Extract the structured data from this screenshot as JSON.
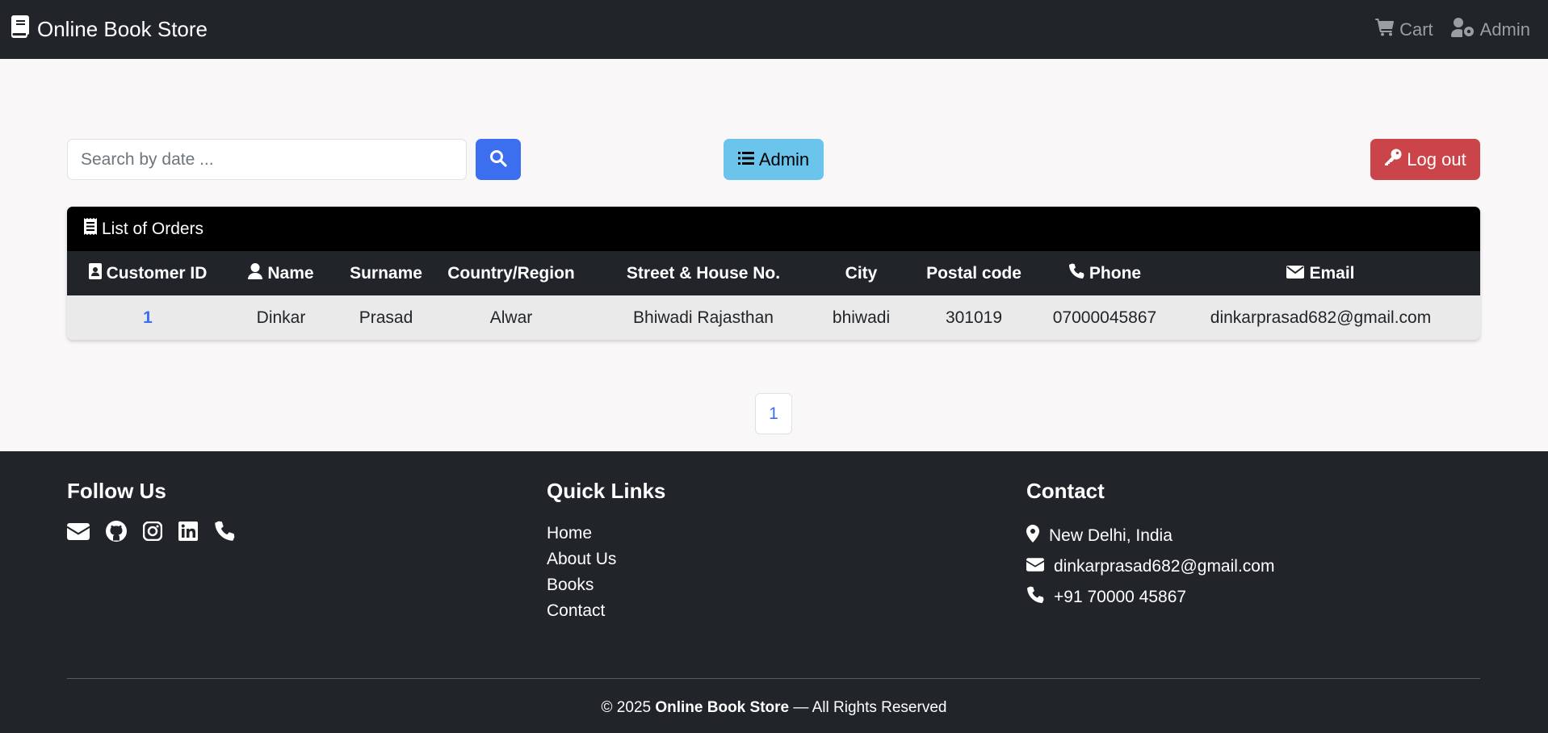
{
  "navbar": {
    "brand": "Online Book Store",
    "cart_label": "Cart",
    "admin_label": "Admin"
  },
  "controls": {
    "search_placeholder": "Search by date ...",
    "admin_button_label": "Admin",
    "logout_button_label": "Log out"
  },
  "orders": {
    "title": "List of Orders",
    "columns": [
      "Customer ID",
      "Name",
      "Surname",
      "Country/Region",
      "Street & House No.",
      "City",
      "Postal code",
      "Phone",
      "Email"
    ],
    "rows": [
      {
        "customer_id": "1",
        "name": "Dinkar",
        "surname": "Prasad",
        "country": "Alwar",
        "street": "Bhiwadi Rajasthan",
        "city": "bhiwadi",
        "postal_code": "301019",
        "phone": "07000045867",
        "email": "dinkarprasad682@gmail.com"
      }
    ]
  },
  "pagination": {
    "current_page": "1"
  },
  "footer": {
    "follow_title": "Follow Us",
    "social_icons": [
      "envelope-icon",
      "github-icon",
      "instagram-icon",
      "linkedin-icon",
      "phone-icon"
    ],
    "quick_links_title": "Quick Links",
    "quick_links": [
      "Home",
      "About Us",
      "Books",
      "Contact"
    ],
    "contact_title": "Contact",
    "contact_location": "New Delhi, India",
    "contact_email": "dinkarprasad682@gmail.com",
    "contact_phone": "+91 70000 45867",
    "copyright_prefix": "© 2025",
    "copyright_brand": "Online Book Store",
    "copyright_suffix": "— All Rights Reserved"
  },
  "colors": {
    "navbar_bg": "#212529",
    "primary": "#3b6ff0",
    "info": "#6ac4ec",
    "danger": "#cb444a",
    "page_bg": "#f9f7f8"
  }
}
